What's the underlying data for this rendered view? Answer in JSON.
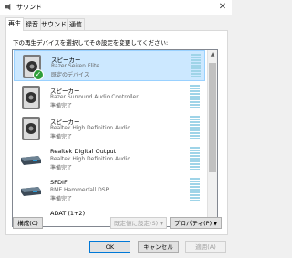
{
  "window": {
    "title": "サウンド",
    "close_glyph": "✕"
  },
  "tabs": [
    {
      "label": "再生",
      "active": true
    },
    {
      "label": "録音",
      "active": false
    },
    {
      "label": "サウンド",
      "active": false
    },
    {
      "label": "通信",
      "active": false
    }
  ],
  "instruction": "下の再生デバイスを選択してその設定を変更してください:",
  "devices": [
    {
      "name": "スピーカー",
      "description": "Razer Seiren Elite",
      "status": "既定のデバイス",
      "icon": "speaker-icon",
      "selected": true,
      "default_check": true
    },
    {
      "name": "スピーカー",
      "description": "Razer Surround Audio Controller",
      "status": "準備完了",
      "icon": "speaker-icon",
      "selected": false
    },
    {
      "name": "スピーカー",
      "description": "Realtek High Definition Audio",
      "status": "準備完了",
      "icon": "speaker-icon",
      "selected": false
    },
    {
      "name": "Realtek Digital Output",
      "description": "Realtek High Definition Audio",
      "status": "準備完了",
      "icon": "digital-output-icon",
      "selected": false
    },
    {
      "name": "SPDIF",
      "description": "RME Hammerfall DSP",
      "status": "準備完了",
      "icon": "digital-output-icon",
      "selected": false
    },
    {
      "name": "ADAT (1+2)",
      "description": "",
      "status": "",
      "icon": "digital-output-icon",
      "selected": false
    }
  ],
  "buttons": {
    "configure": "構成(C)",
    "set_default": "既定値に設定(S)",
    "properties": "プロパティ(P)",
    "ok": "OK",
    "cancel": "キャンセル",
    "apply": "適用(A)"
  },
  "colors": {
    "selection": "#cce8ff",
    "meter": "#9fd4e8",
    "check": "#2e9e3a"
  }
}
